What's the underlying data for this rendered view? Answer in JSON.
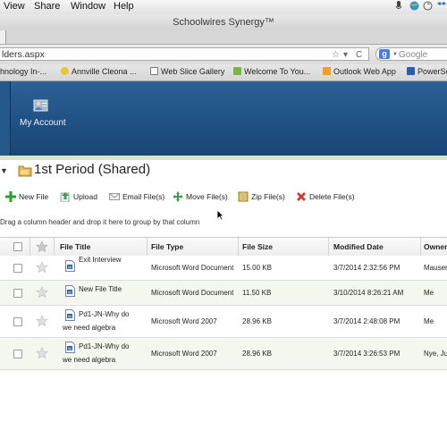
{
  "menubar": {
    "items": [
      "View",
      "Share",
      "Window",
      "Help"
    ]
  },
  "window": {
    "title": "Schoolwires Synergy™"
  },
  "addressbar": {
    "url": "lders.aspx",
    "search_placeholder": "Google"
  },
  "bookmarks": [
    {
      "label": "hnology In-...",
      "color": "#6a8fbf"
    },
    {
      "label": "Annville Cleona ...",
      "color": "#e8c43a"
    },
    {
      "label": "Web Slice Gallery",
      "color": "#ffffff"
    },
    {
      "label": "Welcome To You...",
      "color": "#7cb342"
    },
    {
      "label": "Outlook Web App",
      "color": "#f0a020"
    },
    {
      "label": "PowerSc",
      "color": "#2a5db0"
    }
  ],
  "header": {
    "my_account": "My Account"
  },
  "page": {
    "title": "1st Period (Shared)"
  },
  "toolbar": {
    "new_file": "New File",
    "upload": "Upload",
    "email": "Email File(s)",
    "move": "Move File(s)",
    "zip": "Zip File(s)",
    "delete": "Delete File(s)"
  },
  "grid": {
    "groupby_hint": "Drag a column header and drop it here to group by that column",
    "columns": [
      "File Title",
      "File Type",
      "File Size",
      "Modified Date",
      "Owner"
    ],
    "rows": [
      {
        "title1": "Exit Interview",
        "title2": "",
        "type": "Microsoft Word Document",
        "size": "15.00 KB",
        "date": "3/7/2014 2:32:56 PM",
        "owner": "Mauser,"
      },
      {
        "title1": "New File Title",
        "title2": "",
        "type": "Microsoft Word Document",
        "size": "11.50 KB",
        "date": "3/10/2014 8:26:21 AM",
        "owner": "Me"
      },
      {
        "title1": "Pd1-JN-Why do",
        "title2": "we need algebra",
        "type": "Microsoft Word 2007",
        "size": "28.96 KB",
        "date": "3/7/2014 2:48:08 PM",
        "owner": "Me"
      },
      {
        "title1": "Pd1-JN-Why do",
        "title2": "we need algebra",
        "type": "Microsoft Word 2007",
        "size": "28.96 KB",
        "date": "3/7/2014 3:26:53 PM",
        "owner": "Nye, Ju"
      }
    ]
  }
}
